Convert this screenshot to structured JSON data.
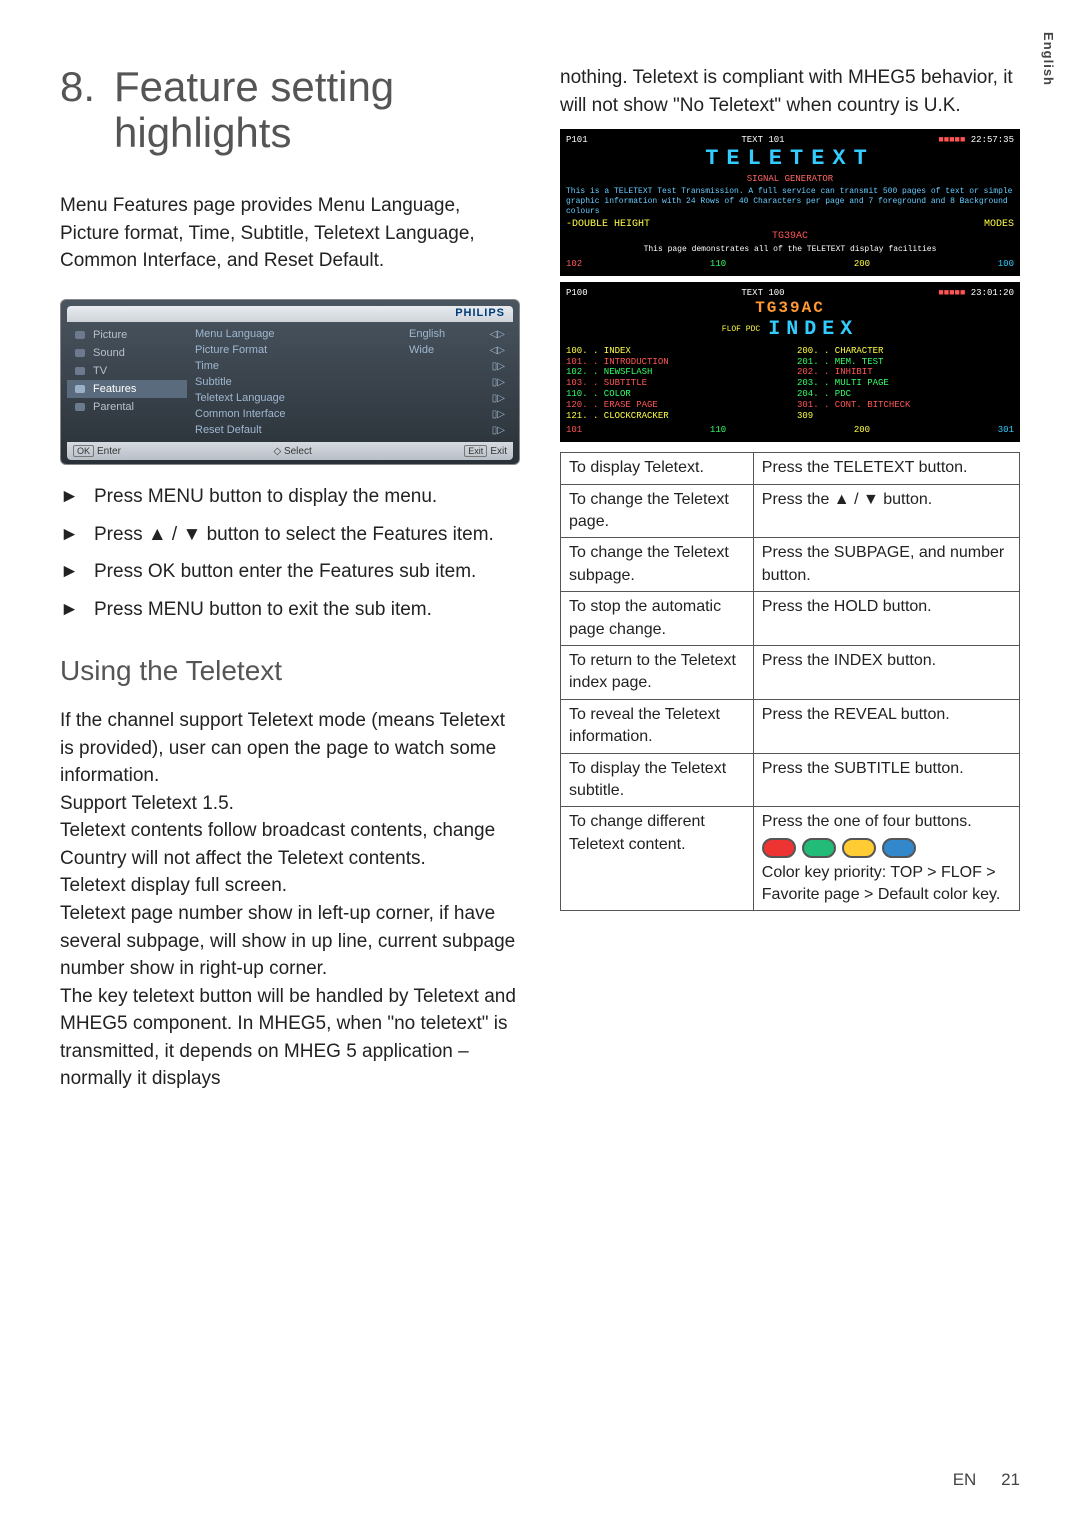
{
  "side_tab": "English",
  "footer": {
    "lang": "EN",
    "page": "21"
  },
  "title": {
    "number": "8.",
    "text_line1": "Feature setting",
    "text_line2": "highlights"
  },
  "intro": "Menu Features page provides Menu Language, Picture format, Time, Subtitle, Teletext Language, Common Interface, and Reset Default.",
  "menu": {
    "brand": "PHILIPS",
    "left": [
      {
        "label": "Picture"
      },
      {
        "label": "Sound"
      },
      {
        "label": "TV"
      },
      {
        "label": "Features"
      },
      {
        "label": "Parental"
      }
    ],
    "selected_index": 3,
    "rows": [
      {
        "label": "Menu Language",
        "value": "English",
        "glyph": "◁▷"
      },
      {
        "label": "Picture Format",
        "value": "Wide",
        "glyph": "◁▷"
      },
      {
        "label": "Time",
        "value": "",
        "glyph": "▯▷"
      },
      {
        "label": "Subtitle",
        "value": "",
        "glyph": "▯▷"
      },
      {
        "label": "Teletext Language",
        "value": "",
        "glyph": "▯▷"
      },
      {
        "label": "Common Interface",
        "value": "",
        "glyph": "▯▷"
      },
      {
        "label": "Reset Default",
        "value": "",
        "glyph": "▯▷"
      }
    ],
    "footer": {
      "enter_key": "OK",
      "enter_label": "Enter",
      "select_glyph": "◇",
      "select_label": "Select",
      "exit_key": "Exit",
      "exit_label": "Exit"
    }
  },
  "steps": [
    "Press MENU button to display the menu.",
    "Press ▲ / ▼ button to select the Features item.",
    "Press OK button enter the Features sub item.",
    "Press MENU button to exit the sub item."
  ],
  "teletext_heading": "Using the Teletext",
  "teletext_paras": [
    "If the channel support Teletext mode (means Teletext is provided), user can open the page to watch some information.",
    "Support Teletext 1.5.",
    "Teletext contents follow broadcast contents, change Country will not affect the Teletext contents.",
    "Teletext display full screen.",
    "Teletext page number show in left-up corner, if have several subpage, will show in up line, current subpage number show in right-up corner.",
    "The key teletext button will be handled by Teletext and MHEG5 component. In MHEG5, when \"no teletext\" is transmitted, it depends on MHEG 5 application – normally it displays"
  ],
  "continuation": "nothing. Teletext is compliant with MHEG5 behavior, it will not show \"No Teletext\" when country is U.K.",
  "ttx1": {
    "head_left": "P101",
    "head_mid": "TEXT 101",
    "head_right": "22:57:35",
    "title": "TELETEXT",
    "sub": "SIGNAL GENERATOR",
    "lines": "This is a TELETEXT Test Transmission. A full service can transmit 500 pages of text or simple graphic information with 24 Rows of 40 Characters per page and 7 foreground and 8 Background colours",
    "double": "-DOUBLE HEIGHT",
    "modes": "MODES",
    "tg": "TG39AC",
    "demo": "This page demonstrates all of the TELETEXT display facilities",
    "foot": [
      "102",
      "110",
      "200",
      "100"
    ]
  },
  "ttx2": {
    "head_left": "P100",
    "head_mid": "TEXT 100",
    "head_right": "23:01:20",
    "tg": "TG39AC",
    "index_label": "FLOF PDC",
    "index_title": "INDEX",
    "col1": [
      "100. . INDEX",
      "101. . INTRODUCTION",
      "102. . NEWSFLASH",
      "103. . SUBTITLE",
      "110. . COLOR",
      "120. . ERASE PAGE",
      "121. . CLOCKCRACKER"
    ],
    "col2": [
      "200. . CHARACTER",
      "201. . MEM. TEST",
      "202. . INHIBIT",
      "203. . MULTI PAGE",
      "204. . PDC",
      "301. . CONT. BITCHECK",
      "309"
    ],
    "foot": [
      "101",
      "110",
      "200",
      "301"
    ]
  },
  "actions": [
    {
      "a": "To display Teletext.",
      "b": "Press the TELETEXT button."
    },
    {
      "a": "To change the Teletext page.",
      "b": "Press the ▲ / ▼ button."
    },
    {
      "a": "To change the Teletext subpage.",
      "b": "Press the SUBPAGE, and number button."
    },
    {
      "a": "To stop the automatic page change.",
      "b": "Press the HOLD button."
    },
    {
      "a": "To return to the Teletext index page.",
      "b": "Press the INDEX button."
    },
    {
      "a": "To reveal the Teletext information.",
      "b": "Press the REVEAL button."
    },
    {
      "a": "To display the Teletext subtitle.",
      "b": "Press the SUBTITLE button."
    }
  ],
  "action_last": {
    "a": "To change different Teletext content.",
    "b1": "Press the one of four buttons.",
    "b2": "Color key priority: TOP > FLOF > Favorite page > Default color key."
  }
}
